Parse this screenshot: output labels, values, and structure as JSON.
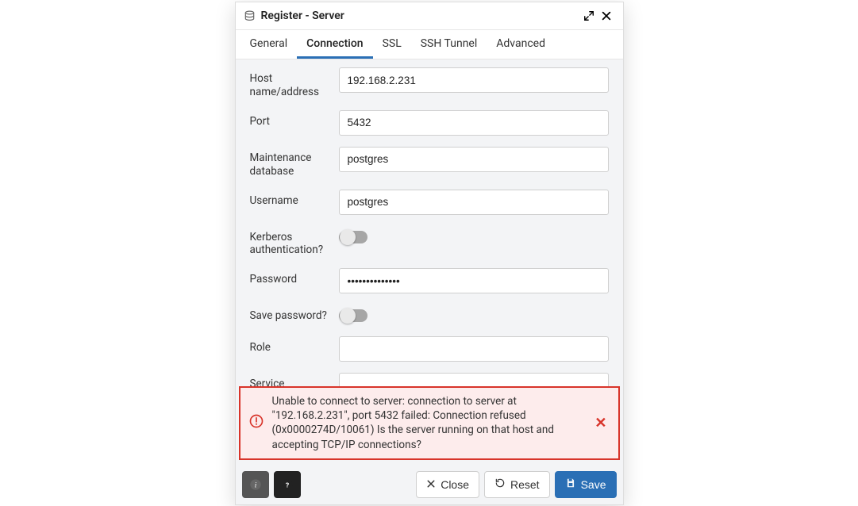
{
  "dialog": {
    "title": "Register - Server"
  },
  "tabs": [
    "General",
    "Connection",
    "SSL",
    "SSH Tunnel",
    "Advanced"
  ],
  "active_tab_index": 1,
  "form": {
    "host": {
      "label": "Host name/address",
      "value": "192.168.2.231"
    },
    "port": {
      "label": "Port",
      "value": "5432"
    },
    "maintdb": {
      "label": "Maintenance database",
      "value": "postgres"
    },
    "username": {
      "label": "Username",
      "value": "postgres"
    },
    "kerberos": {
      "label": "Kerberos authentication?",
      "on": false
    },
    "password": {
      "label": "Password",
      "value": "••••••••••••••"
    },
    "savepw": {
      "label": "Save password?",
      "on": false
    },
    "role": {
      "label": "Role",
      "value": ""
    },
    "service": {
      "label": "Service",
      "value": ""
    }
  },
  "error": {
    "text": "Unable to connect to server: connection to server at \"192.168.2.231\", port 5432 failed: Connection refused (0x0000274D/10061) Is the server running on that host and accepting TCP/IP connections?"
  },
  "footer": {
    "close": "Close",
    "reset": "Reset",
    "save": "Save"
  }
}
